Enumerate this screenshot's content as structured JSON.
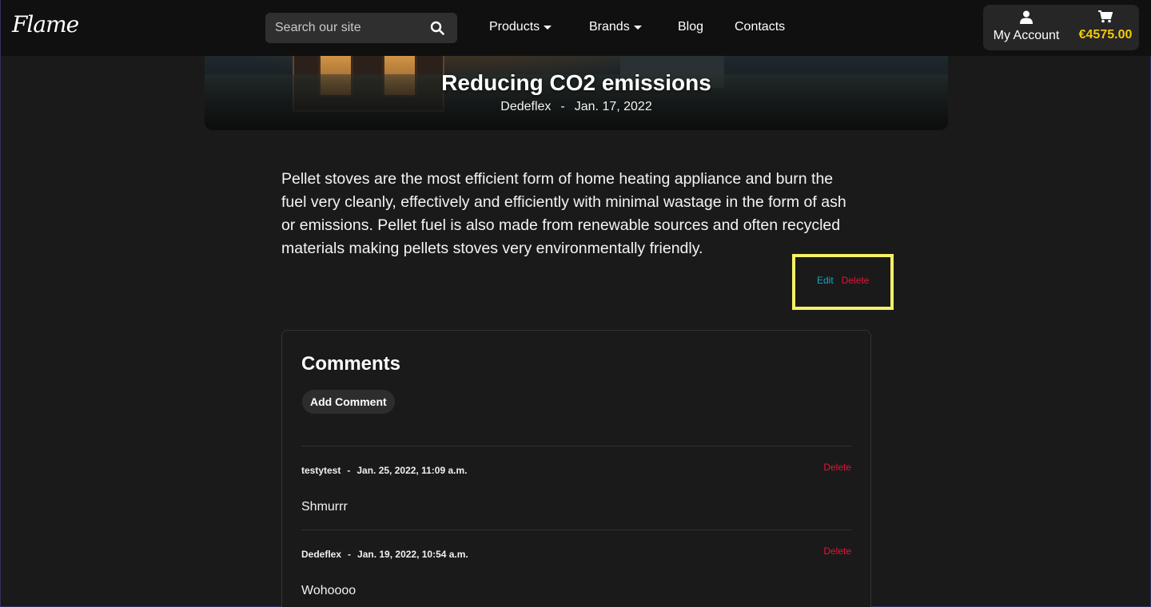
{
  "brand": {
    "logo_text": "Flame"
  },
  "search": {
    "placeholder": "Search our site"
  },
  "nav": {
    "products": "Products",
    "brands": "Brands",
    "blog": "Blog",
    "contacts": "Contacts"
  },
  "account": {
    "label": "My Account",
    "cart_total": "€4575.00"
  },
  "post": {
    "title": "Reducing CO2 emissions",
    "author": "Dedeflex",
    "separator": "-",
    "date": "Jan. 17, 2022",
    "body": "Pellet stoves are the most efficient form of home heating appliance and burn the fuel very cleanly, effectively and efficiently with minimal wastage in the form of ash or emissions. Pellet fuel is also made from renewable sources and often recycled materials making pellets stoves very environmentally friendly.",
    "edit_label": "Edit",
    "delete_label": "Delete"
  },
  "comments": {
    "heading": "Comments",
    "add_label": "Add Comment",
    "items": [
      {
        "author": "testytest",
        "separator": "-",
        "date": "Jan. 25, 2022, 11:09 a.m.",
        "body": "Shmurrr",
        "delete_label": "Delete"
      },
      {
        "author": "Dedeflex",
        "separator": "-",
        "date": "Jan. 19, 2022, 10:54 a.m.",
        "body": "Wohoooo",
        "delete_label": "Delete"
      }
    ]
  },
  "colors": {
    "accent_gold": "#f2c80f",
    "edit_link": "#13a9c5",
    "delete_link": "#e0153c",
    "highlight": "#f5f066"
  }
}
